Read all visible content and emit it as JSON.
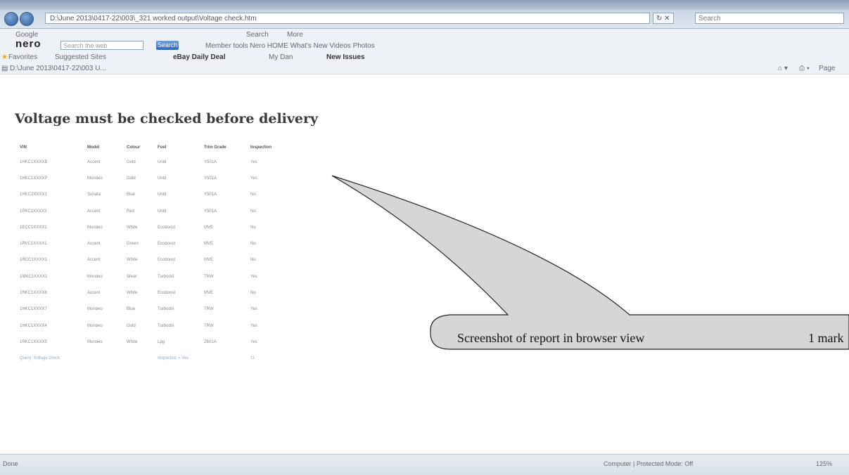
{
  "window": {
    "title": "D:\\June 2013\\...\\Voltage check.htm"
  },
  "address_bar": {
    "url": "D:\\June 2013\\0417-22\\003\\_321 worked output\\Voltage check.htm",
    "refresh_label": "↻ ✕",
    "search_placeholder": "Search"
  },
  "google_bar": {
    "label": "Google",
    "search_label": "Search",
    "more_label": "More"
  },
  "nero_bar": {
    "logo": "nero",
    "search_placeholder": "Search the web",
    "search_button": "Search",
    "links": "Member tools  Nero HOME  What's New  Videos  Photos"
  },
  "favorites_bar": {
    "favorites_label": "Favorites",
    "suggested_sites": "Suggested Sites",
    "ebay_deal": "eBay Daily Deal",
    "item_3": "My Dan",
    "new_issues": "New Issues"
  },
  "tab": {
    "label": "D:\\June 2013\\0417-22\\003 U..."
  },
  "command_bar": {
    "page_menu": "Page"
  },
  "page": {
    "title": "Voltage must be checked before delivery",
    "columns": [
      "VIN",
      "Model",
      "Colour",
      "Fuel",
      "Trim Grade",
      "Inspection"
    ],
    "rows": [
      [
        "1HKC1XXXXB",
        "Accent",
        "Gold",
        "Unld",
        "Y501A",
        "Yes"
      ],
      [
        "1HKC1XXXXP",
        "Mondeo",
        "Gold",
        "Unld",
        "Y501A",
        "Yes"
      ],
      [
        "1HKC2XXXX1",
        "Sonata",
        "Blue",
        "Unld",
        "Y501A",
        "No"
      ],
      [
        "1PKC1XXXX3",
        "Accent",
        "Red",
        "Unld",
        "Y501A",
        "No"
      ],
      [
        "1ECC1XXXX1",
        "Mondeo",
        "White",
        "Ecoboost",
        "MVE",
        "No"
      ],
      [
        "1RVC1XXXX1",
        "Accent",
        "Green",
        "Ecoboost",
        "MVE",
        "No"
      ],
      [
        "1RCC1XXXX1",
        "Accent",
        "White",
        "Ecoboost",
        "MVE",
        "No"
      ],
      [
        "1MKC1XXXX1",
        "Mondeo",
        "Silver",
        "Turbodsl",
        "TRW",
        "Yes"
      ],
      [
        "1RKC1XXXX8",
        "Accent",
        "White",
        "Ecoboost",
        "MVE",
        "No"
      ],
      [
        "1HKC1XXXX7",
        "Mondeo",
        "Blue",
        "Turbodsl",
        "TRW",
        "Yes"
      ],
      [
        "1HKC1XXXX4",
        "Mondeo",
        "Gold",
        "Turbodsl",
        "TRW",
        "Yes"
      ],
      [
        "1RKC1XXXX5",
        "Mondeo",
        "White",
        "Lpg",
        "Z601A",
        "Yes"
      ]
    ],
    "footer_left": "Query: Voltage check",
    "footer_mid": "Inspection = Yes",
    "footer_count": "11"
  },
  "callout": {
    "text": "Screenshot of report in browser view",
    "marks": "1 mark"
  },
  "status_bar": {
    "left": "Done",
    "zone": "Computer | Protected Mode: Off",
    "zoom": "125%"
  }
}
